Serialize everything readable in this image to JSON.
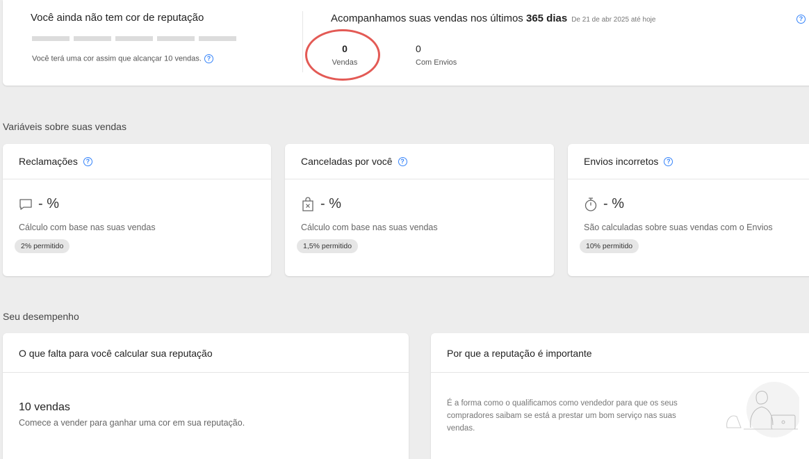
{
  "reputation": {
    "title": "Você ainda não tem cor de reputação",
    "note": "Você terá uma cor assim que alcançar 10 vendas."
  },
  "tracking": {
    "title_prefix": "Acompanhamos suas vendas nos últimos ",
    "title_days": "365 dias",
    "date_range": "De 21 de abr 2025 até hoje",
    "sales_value": "0",
    "sales_label": "Vendas",
    "shipping_value": "0",
    "shipping_label": "Com Envios"
  },
  "variables_section": {
    "title": "Variáveis sobre suas vendas",
    "cards": [
      {
        "title": "Reclamações",
        "value": "- %",
        "description": "Cálculo com base nas suas vendas",
        "allowed": "2% permitido",
        "icon": "chat-bubble-icon"
      },
      {
        "title": "Canceladas por você",
        "value": "- %",
        "description": "Cálculo com base nas suas vendas",
        "allowed": "1,5% permitido",
        "icon": "cancelled-bag-icon"
      },
      {
        "title": "Envios incorretos",
        "value": "- %",
        "description": "São calculadas sobre suas vendas com o Envios",
        "allowed": "10% permitido",
        "icon": "stopwatch-icon"
      }
    ]
  },
  "performance_section": {
    "title": "Seu desempenho",
    "goal_card": {
      "title": "O que falta para você calcular sua reputação",
      "goal": "10 vendas",
      "description": "Comece a vender para ganhar uma cor em sua reputação."
    },
    "why_card": {
      "title": "Por que a reputação é importante",
      "text": "É a forma como o qualificamos como vendedor para que os seus compradores saibam se está a prestar um bom serviço nas suas vendas."
    }
  },
  "colors": {
    "accent": "#3483fa",
    "highlight_circle": "#e35a55",
    "background": "#ededed"
  }
}
